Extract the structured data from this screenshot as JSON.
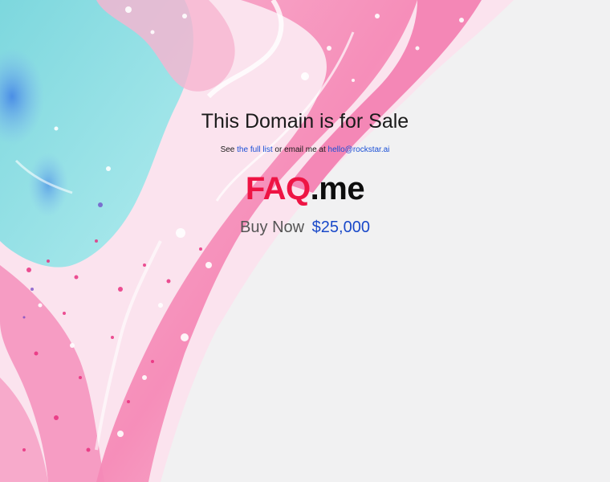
{
  "headline": "This Domain is for Sale",
  "subline": {
    "prefix": "See",
    "list_link": "the full list",
    "middle": "or email me at",
    "email_link": "hello@rockstar.ai"
  },
  "domain": {
    "name": "FAQ",
    "tld": ".me"
  },
  "offer": {
    "buy_label": "Buy Now",
    "price": "$25,000"
  },
  "colors": {
    "domain_name": "#ee1444",
    "link": "#1a4fd6",
    "price": "#1a49c9",
    "background": "#f1f1f2"
  }
}
